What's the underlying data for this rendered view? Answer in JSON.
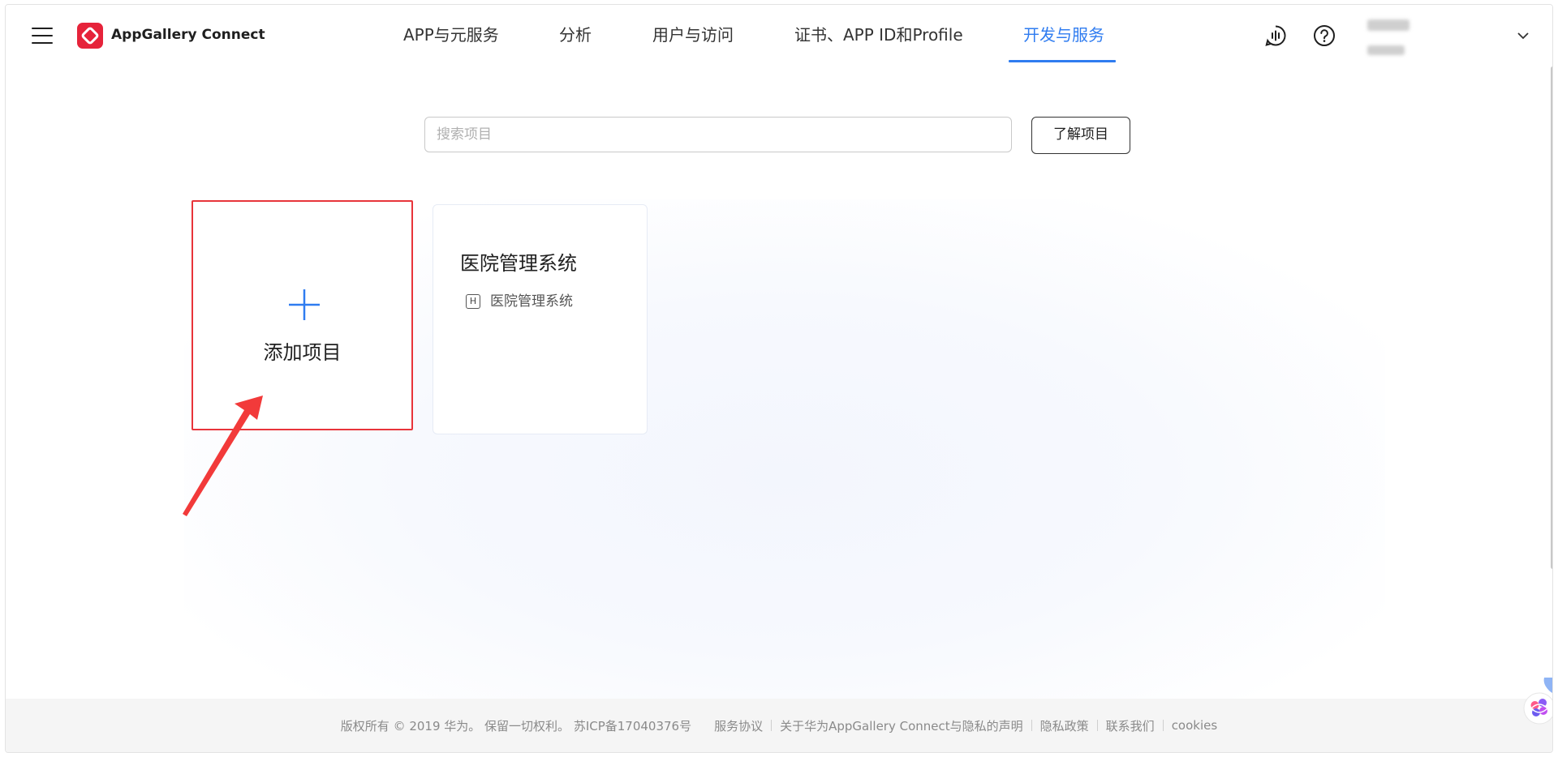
{
  "header": {
    "brand": "AppGallery Connect",
    "tabs": [
      {
        "label": "APP与元服务",
        "active": false
      },
      {
        "label": "分析",
        "active": false
      },
      {
        "label": "用户与访问",
        "active": false
      },
      {
        "label": "证书、APP ID和Profile",
        "active": false
      },
      {
        "label": "开发与服务",
        "active": true
      }
    ],
    "accent_color": "#2f7cf0",
    "icons": [
      "menu-icon",
      "voice-support-icon",
      "help-icon",
      "chevron-down-icon"
    ]
  },
  "search": {
    "placeholder": "搜索项目",
    "value": "",
    "learn_button": "了解项目"
  },
  "cards": {
    "add_project_label": "添加项目",
    "projects": [
      {
        "title": "医院管理系统",
        "app_badge": "H",
        "app_name": "医院管理系统"
      }
    ]
  },
  "annotation": {
    "highlight_color": "#e8343a"
  },
  "footer": {
    "copyright": "版权所有 © 2019 华为。 保留一切权利。 苏ICP备17040376号",
    "links": [
      "服务协议",
      "关于华为AppGallery Connect与隐私的声明",
      "隐私政策",
      "联系我们",
      "cookies"
    ]
  }
}
